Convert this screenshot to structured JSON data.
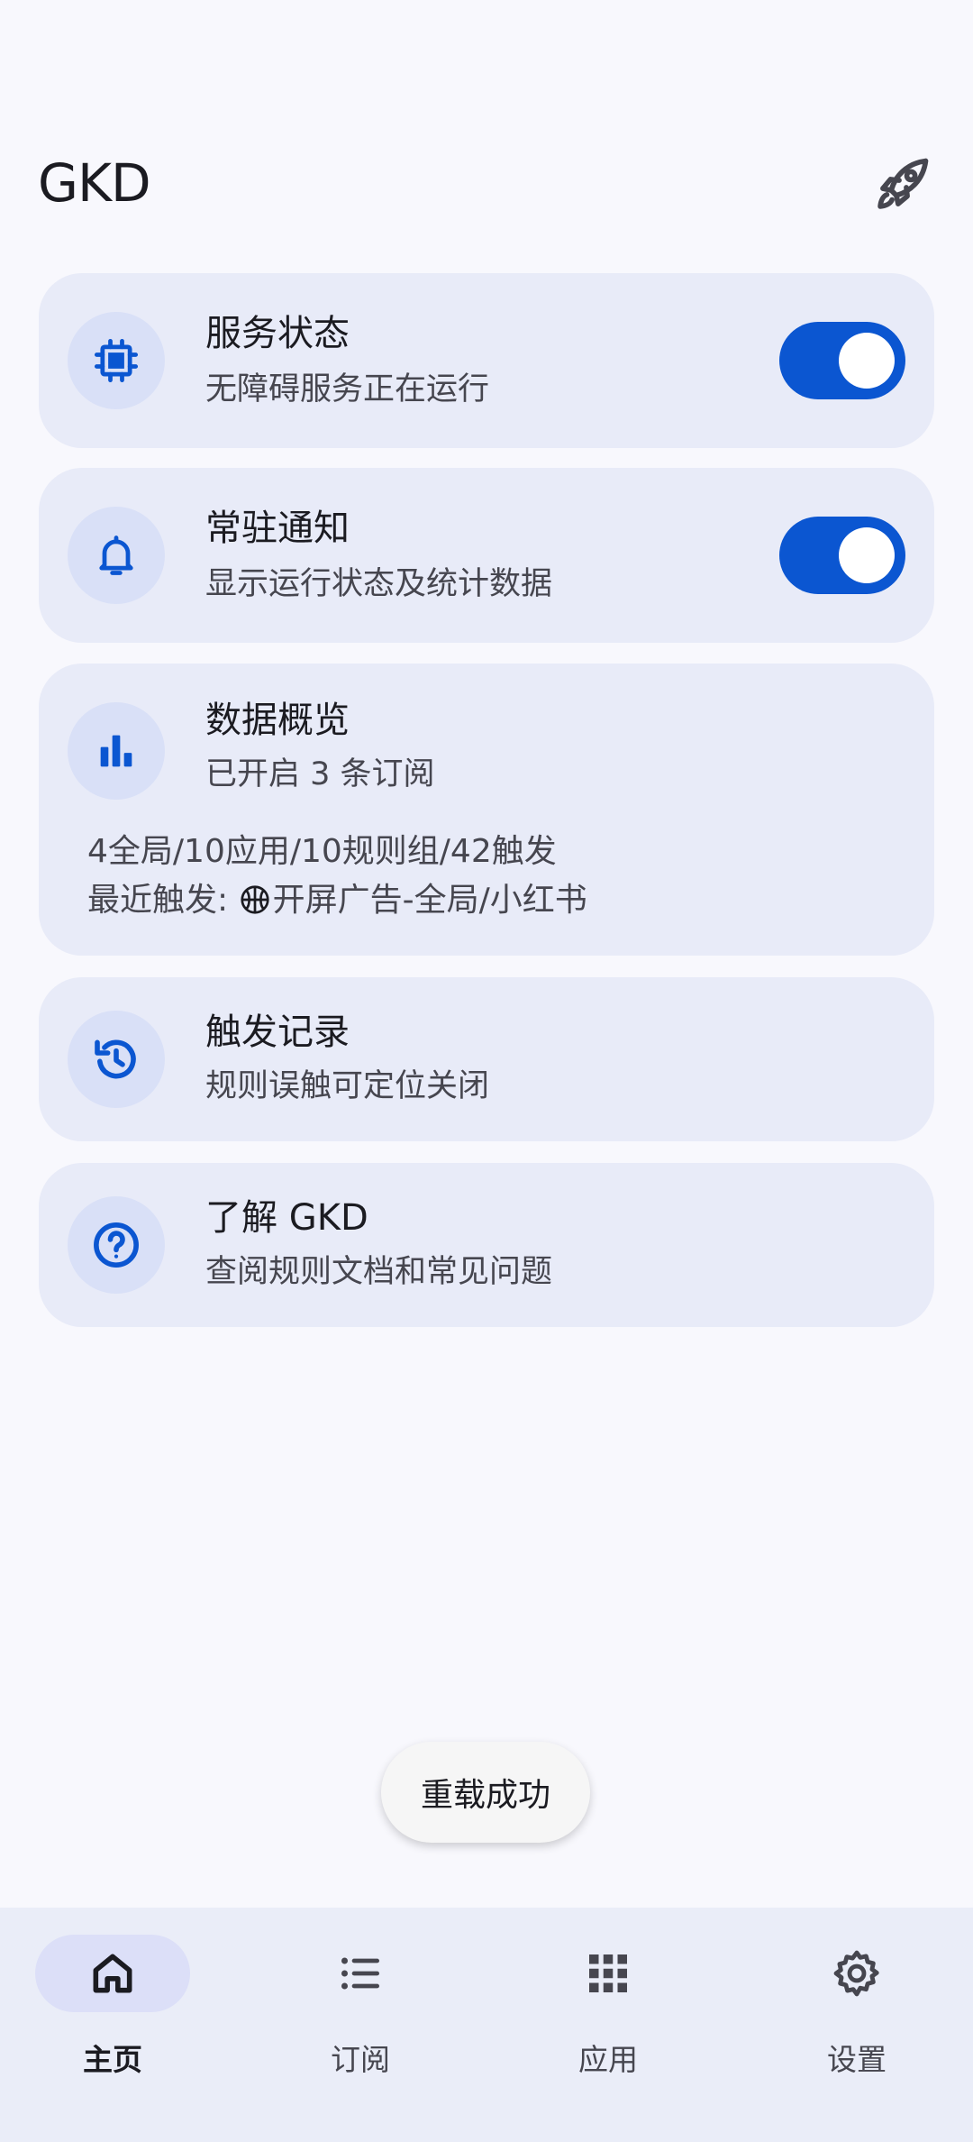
{
  "app": {
    "title": "GKD"
  },
  "cards": {
    "service": {
      "title": "服务状态",
      "subtitle": "无障碍服务正在运行",
      "enabled": true
    },
    "notify": {
      "title": "常驻通知",
      "subtitle": "显示运行状态及统计数据",
      "enabled": true
    },
    "overview": {
      "title": "数据概览",
      "subtitle": "已开启 3 条订阅",
      "stats": "4全局/10应用/10规则组/42触发",
      "recent_label": "最近触发: ",
      "recent_value": "开屏广告-全局/小红书"
    },
    "records": {
      "title": "触发记录",
      "subtitle": "规则误触可定位关闭"
    },
    "about": {
      "title": "了解 GKD",
      "subtitle": "查阅规则文档和常见问题"
    }
  },
  "toast": {
    "text": "重载成功"
  },
  "nav": {
    "home": "主页",
    "subscriptions": "订阅",
    "apps": "应用",
    "settings": "设置",
    "active": "home"
  },
  "colors": {
    "accent": "#0b56d1",
    "card_bg": "#e8ebf8",
    "icon_bg": "#d9e0f7",
    "page_bg": "#f8f8fd"
  },
  "icons": {
    "topbar": "rocket-icon",
    "service": "chip-icon",
    "notify": "bell-icon",
    "overview": "bar-chart-icon",
    "records": "history-icon",
    "about": "help-circle-icon",
    "recent": "basketball-icon"
  }
}
